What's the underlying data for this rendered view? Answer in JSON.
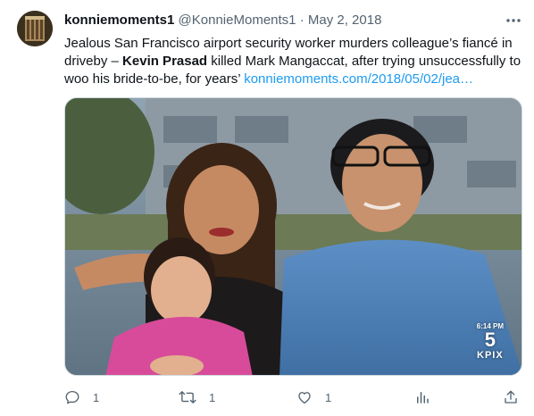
{
  "tweet": {
    "display_name": "konniemoments1",
    "handle": "@KonnieMoments1",
    "separator": "·",
    "date": "May 2, 2018",
    "text_part1": "Jealous San Francisco airport security worker murders colleague’s fiancé in driveby – ",
    "text_bold": "Kevin Prasad",
    "text_part2": " killed Mark Mangaccat, after trying unsuccessfully to woo his bride-to-be, for years’ ",
    "link_text": "konniemoments.com/2018/05/02/jea…",
    "more_icon": "more-horizontal-icon"
  },
  "media": {
    "watermark_time": "6:14 PM",
    "watermark_channel": "5",
    "watermark_callsign": "KPIX"
  },
  "actions": {
    "reply_count": "1",
    "retweet_count": "1",
    "like_count": "1",
    "views_count": "",
    "icons": [
      "reply-icon",
      "retweet-icon",
      "like-icon",
      "views-icon",
      "share-icon"
    ]
  },
  "colors": {
    "text_primary": "#0f1419",
    "text_secondary": "#536471",
    "link": "#1d9bf0",
    "border": "#cfd9de"
  }
}
